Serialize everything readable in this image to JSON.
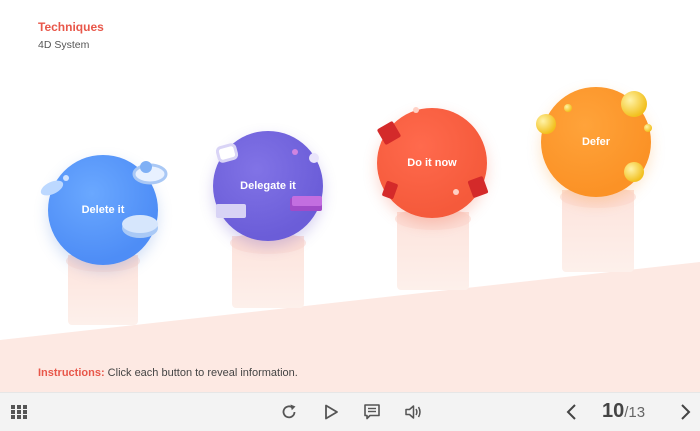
{
  "header": {
    "title": "Techniques",
    "subtitle": "4D System"
  },
  "buttons": {
    "delete": "Delete it",
    "delegate": "Delegate it",
    "do_now": "Do it now",
    "defer": "Defer"
  },
  "colors": {
    "accent": "#e8574a",
    "delete": "#4e8df6",
    "delegate": "#6b5dd8",
    "do_now": "#f55a3b",
    "defer": "#fb9226",
    "background_tint": "#fde9e3"
  },
  "instructions": {
    "label": "Instructions:",
    "text": " Click each button to reveal information."
  },
  "toolbar": {
    "menu_icon": "grid-menu-icon",
    "replay_icon": "replay-icon",
    "play_icon": "play-icon",
    "notes_icon": "notes-icon",
    "volume_icon": "volume-icon",
    "prev_icon": "chevron-left-icon",
    "next_icon": "chevron-right-icon",
    "current_page": "10",
    "total_pages": "/13"
  }
}
